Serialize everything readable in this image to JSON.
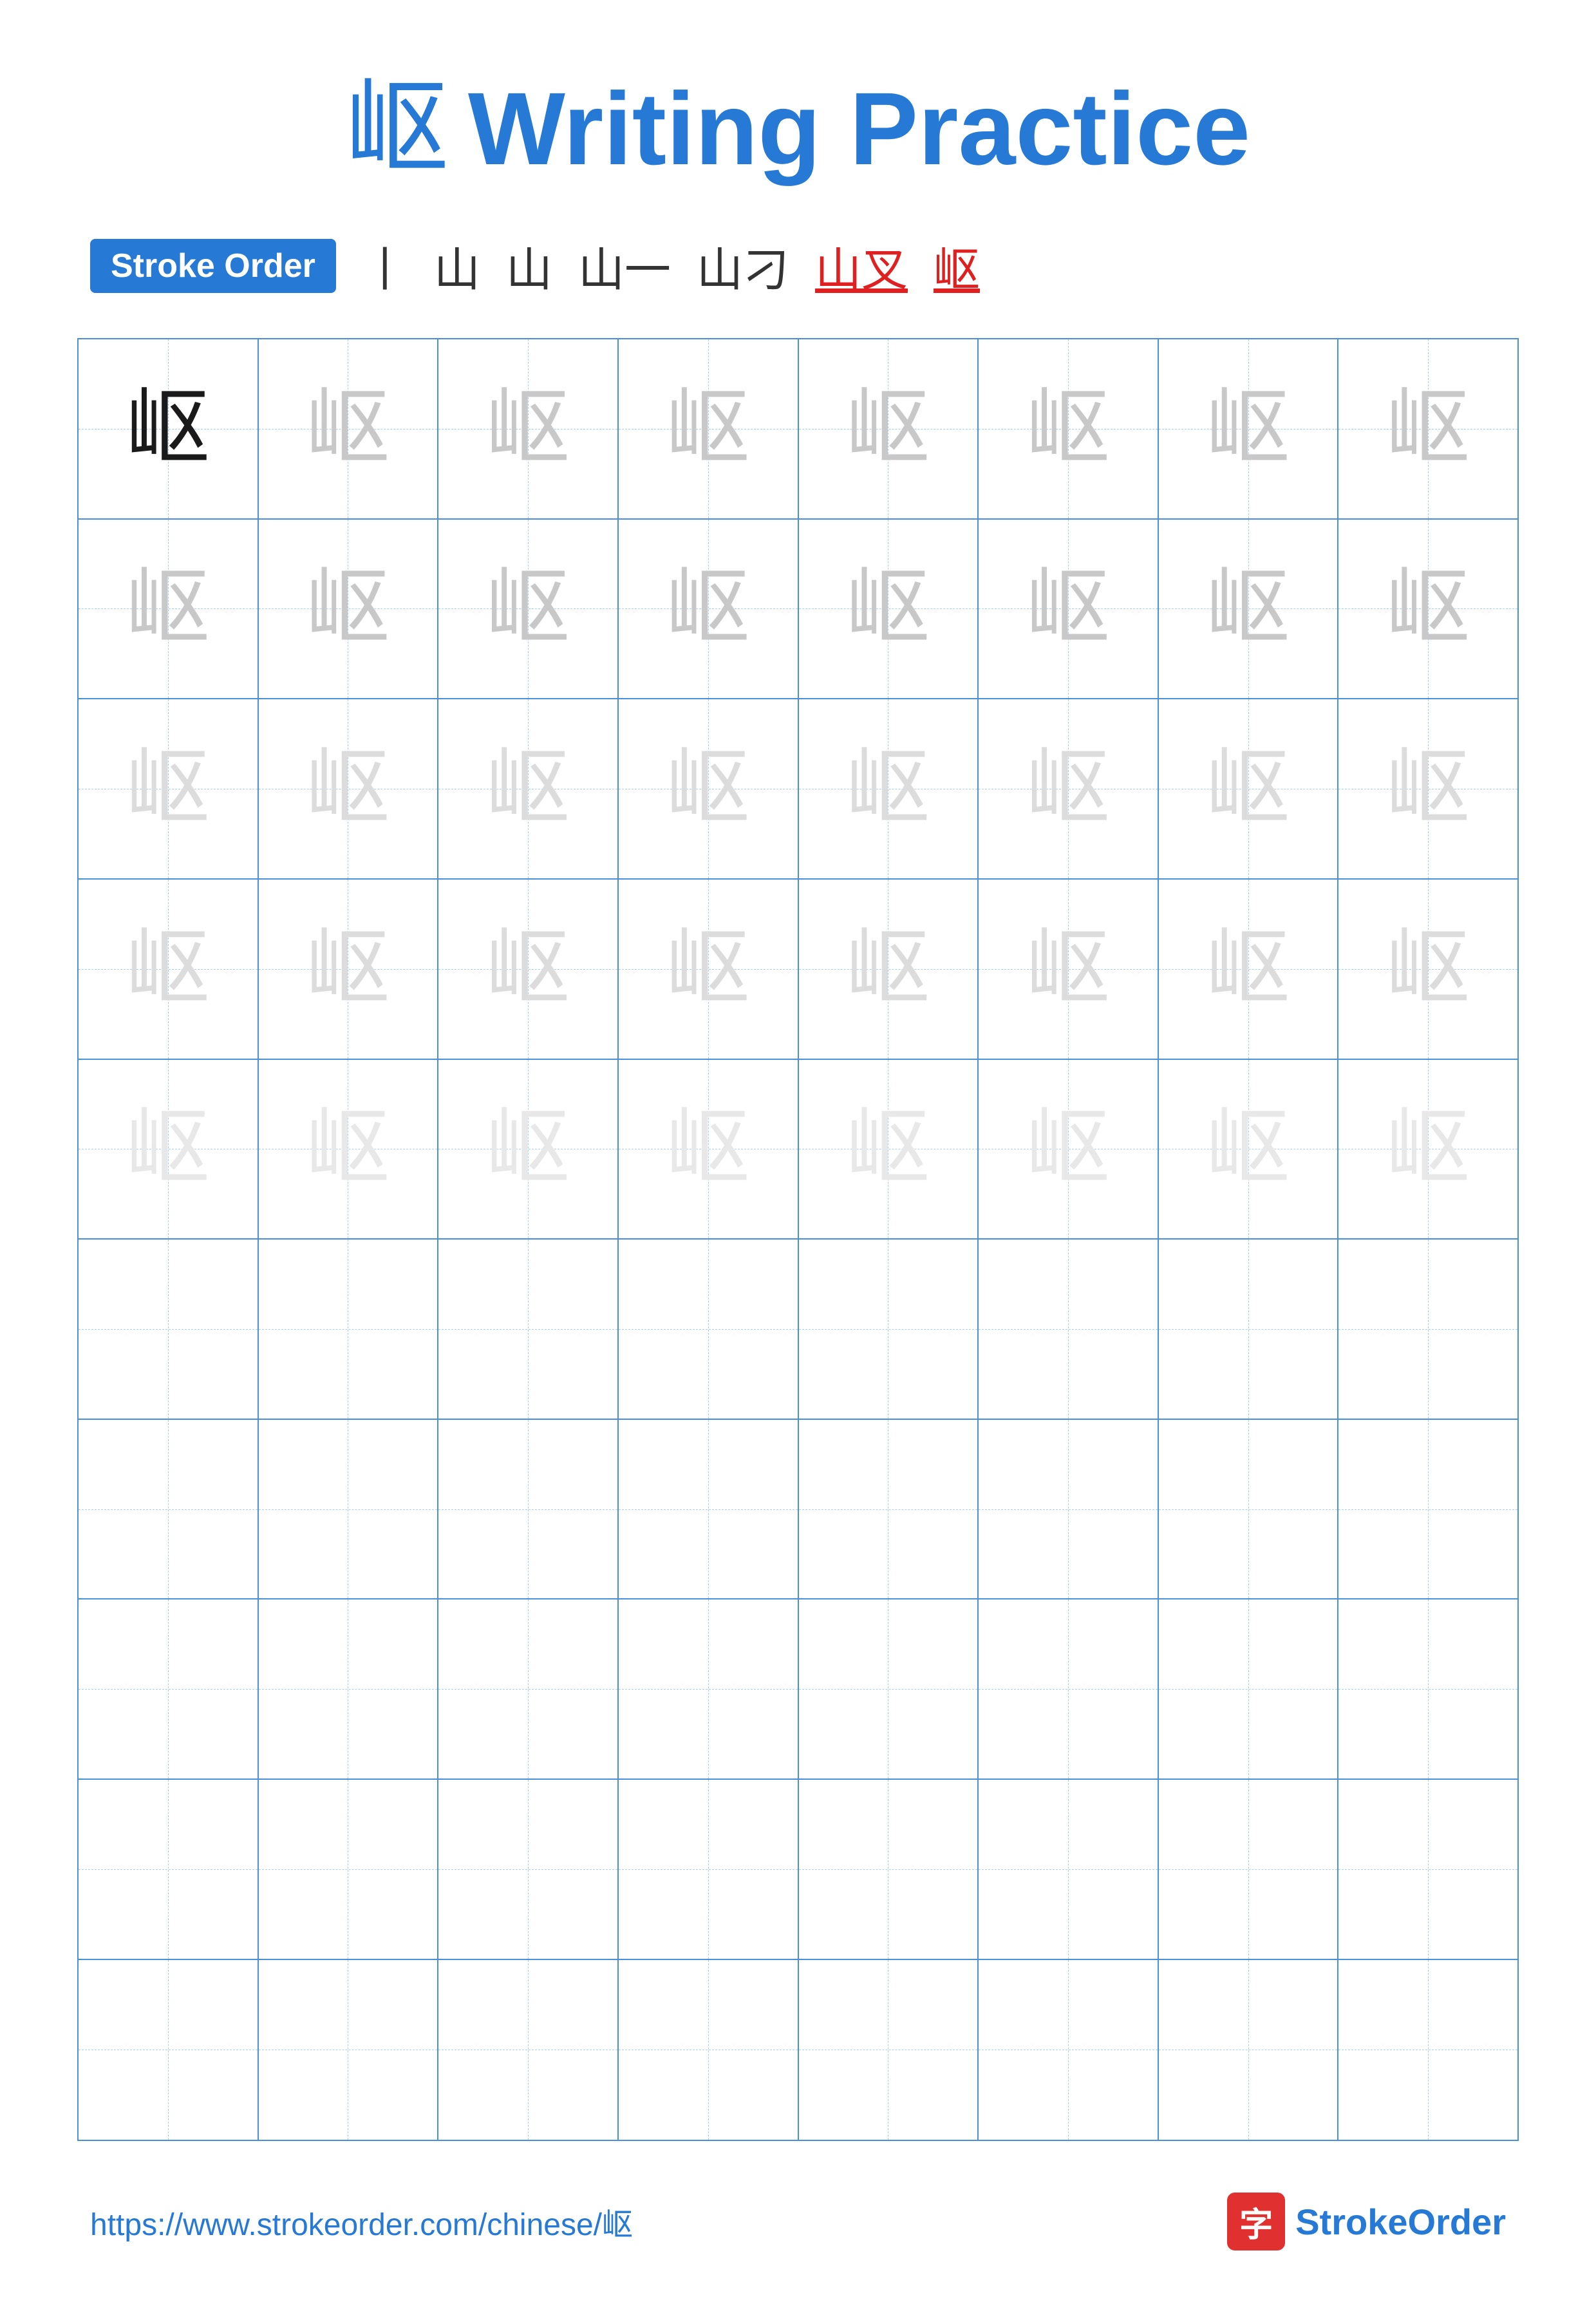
{
  "title": {
    "char": "岖",
    "text": "Writing Practice"
  },
  "stroke_order": {
    "badge_label": "Stroke Order",
    "steps": [
      "丨",
      "山",
      "山",
      "山一",
      "山刁",
      "山叉",
      "岖"
    ]
  },
  "grid": {
    "rows": 10,
    "cols": 8,
    "char": "岖",
    "filled_rows": 5,
    "shades": [
      "dark",
      "medium",
      "medium",
      "light",
      "vlight"
    ]
  },
  "footer": {
    "url": "https://www.strokeorder.com/chinese/岖",
    "logo_char": "字",
    "logo_text": "StrokeOrder"
  }
}
